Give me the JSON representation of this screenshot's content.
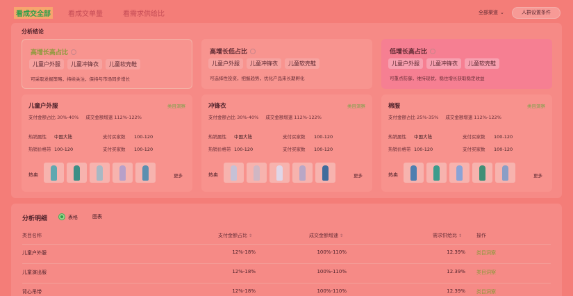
{
  "tabs": [
    "看成交全部",
    "看成交单量",
    "看需求供给比"
  ],
  "topbar": {
    "channel_label": "全部渠道",
    "crowd_button": "人群设置条件"
  },
  "analysis": {
    "title": "分析结论",
    "summaries": [
      {
        "title": "高增长高占比",
        "chips": [
          "儿童户外服",
          "儿童冲锋衣",
          "儿童软壳鞋"
        ],
        "desc": "可采取发掘策略，持续关注，保持与市场同步增长"
      },
      {
        "title": "高增长低占比",
        "chips": [
          "儿童户外服",
          "儿童冲锋衣",
          "儿童软壳鞋"
        ],
        "desc": "可选择性投资，把握趋势，优化产品来长期孵化"
      },
      {
        "title": "低增长高占比",
        "chips": [
          "儿童户外服",
          "儿童冲锋衣",
          "儿童软壳鞋"
        ],
        "desc": "可重点防御，维持现状，稳住增长获取稳定收益"
      }
    ],
    "cards": [
      {
        "name": "儿童户外服",
        "link": "类目洞察",
        "share_label": "支付金额占比",
        "share": "30%-40%",
        "growth_label": "成交金额增速",
        "growth": "112%-122%",
        "attr1_k": "热销属性",
        "attr1_v": "中国大陆",
        "buyers_k": "支付买家数",
        "buyers_v": "100-120",
        "price_k": "热销价格带",
        "price_v": "100-120",
        "buyers2_k": "支付买家数",
        "buyers2_v": "100-120",
        "hot_label": "热卖",
        "more": "更多",
        "thumbs": [
          "#5fa8b0",
          "#3c8f86",
          "#a7b8c4",
          "#b7a0c9",
          "#5b8fb0"
        ]
      },
      {
        "name": "冲锋衣",
        "link": "类目洞察",
        "share_label": "支付金额占比",
        "share": "30%-40%",
        "growth_label": "成交金额增速",
        "growth": "112%-122%",
        "attr1_k": "热销属性",
        "attr1_v": "中国大陆",
        "buyers_k": "支付买家数",
        "buyers_v": "100-120",
        "price_k": "热销价格带",
        "price_v": "100-120",
        "buyers2_k": "支付买家数",
        "buyers2_v": "100-120",
        "hot_label": "热卖",
        "more": "更多",
        "thumbs": [
          "#c6c1d6",
          "#d0b7c4",
          "#dfd6e8",
          "#b9a7c6",
          "#3f6c9c"
        ]
      },
      {
        "name": "棉服",
        "link": "类目洞察",
        "share_label": "支付金额占比",
        "share": "25%-35%",
        "growth_label": "成交金额增速",
        "growth": "112%-122%",
        "attr1_k": "热销属性",
        "attr1_v": "中国大陆",
        "buyers_k": "支付买家数",
        "buyers_v": "100-120",
        "price_k": "热销价格带",
        "price_v": "100-120",
        "buyers2_k": "支付买家数",
        "buyers2_v": "100-120",
        "hot_label": "热卖",
        "more": "更多",
        "thumbs": [
          "#4d7fb0",
          "#3c9c8c",
          "#8aa3d6",
          "#3f8f76",
          "#8a9ec6"
        ]
      }
    ]
  },
  "detail": {
    "title": "分析明细",
    "view_table": "表格",
    "view_chart": "图表",
    "columns": [
      "类目名称",
      "支付金额占比",
      "成交金额增速",
      "需求供给比",
      "操作"
    ],
    "rows": [
      {
        "name": "儿童户外服",
        "share": "12%-18%",
        "growth": "100%-110%",
        "ratio": "12.39%",
        "op": "类目洞察"
      },
      {
        "name": "儿童演出服",
        "share": "12%-18%",
        "growth": "100%-110%",
        "ratio": "12.39%",
        "op": "类目洞察"
      },
      {
        "name": "背心吊带",
        "share": "12%-18%",
        "growth": "100%-110%",
        "ratio": "12.39%",
        "op": "类目洞察"
      }
    ]
  },
  "colors": {
    "accent_green": "#2f9f4a",
    "overlay_red": "#f47d78"
  }
}
